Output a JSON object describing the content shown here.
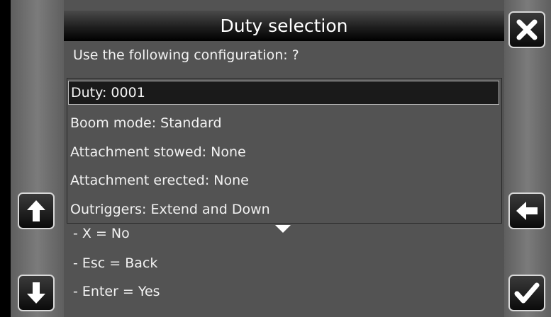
{
  "dialog": {
    "title": "Duty selection",
    "prompt": "Use the following configuration: ?"
  },
  "config_items": [
    "Duty: 0001",
    "Boom mode: Standard",
    "Attachment stowed: None",
    "Attachment erected: None",
    "Outriggers: Extend and Down"
  ],
  "selected_index": 0,
  "hints": [
    "- X = No",
    "- Esc = Back",
    "- Enter = Yes"
  ],
  "buttons": {
    "close": "close-icon",
    "scroll_up": "arrow-up-icon",
    "scroll_down": "arrow-down-icon",
    "back": "arrow-left-icon",
    "confirm": "checkmark-icon"
  }
}
